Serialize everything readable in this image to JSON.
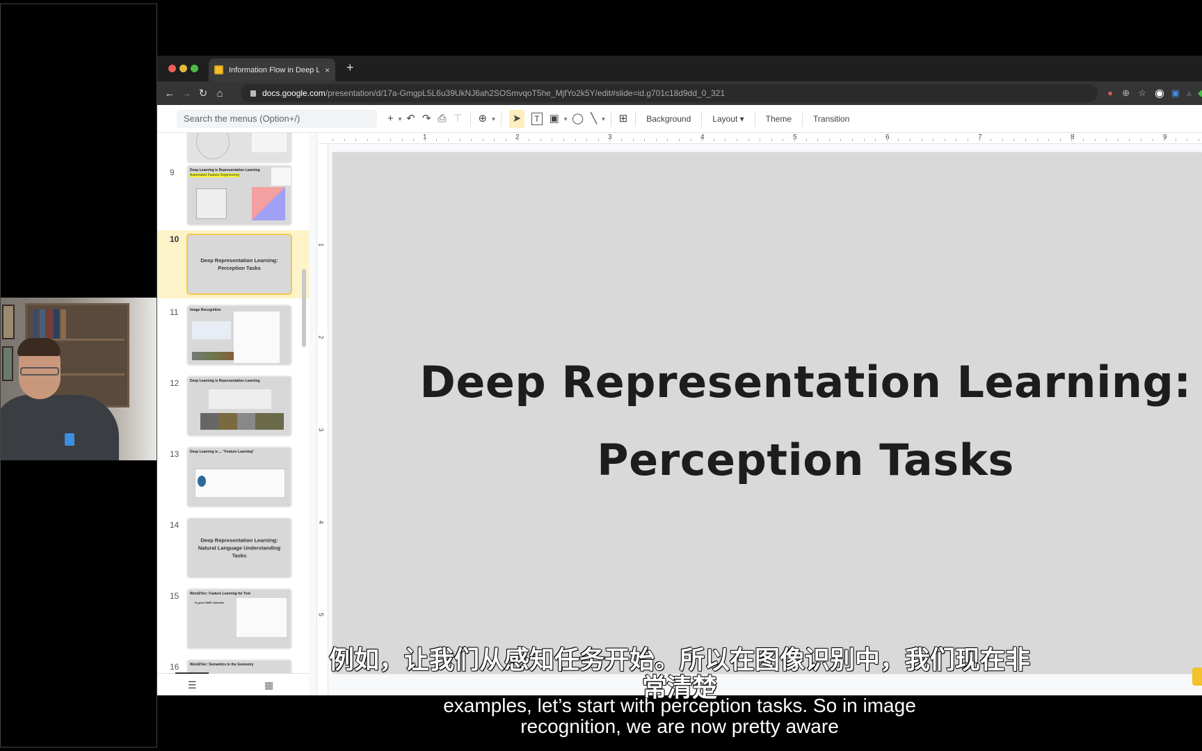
{
  "browser": {
    "tab_title": "Information Flow in Deep Learn",
    "tab_close": "×",
    "new_tab": "+",
    "nav": {
      "back": "←",
      "forward": "→",
      "reload": "↻",
      "home": "⌂"
    },
    "url_host": "docs.google.com",
    "url_path": "/presentation/d/17a-GmgpL5L6u39UkNJ6ah2SOSmvqoT5he_MjfYo2k5Y/edit#slide=id.g701c18d9dd_0_321",
    "extension_icons": [
      "mic-muted-icon",
      "zoom-icon",
      "star-icon",
      "buffer-icon",
      "docs-extension-icon",
      "more-icon",
      "shield-icon"
    ]
  },
  "toolbar": {
    "search_placeholder": "Search the menus (Option+/)",
    "icons": {
      "new": "+",
      "dropdown": "▾",
      "undo": "↶",
      "redo": "↷",
      "print": "⎙",
      "paint_format": "▾",
      "zoom": "⊕",
      "select": "➤",
      "textbox": "T",
      "image": "▣",
      "shape": "◯",
      "line": "╲",
      "comment": "⊞"
    },
    "background_label": "Background",
    "layout_label": "Layout ▾",
    "theme_label": "Theme",
    "transition_label": "Transition"
  },
  "ruler": {
    "horizontal": [
      "1",
      "2",
      "3",
      "4",
      "5",
      "6",
      "7",
      "8",
      "9"
    ],
    "vertical": [
      "1",
      "2",
      "3",
      "4",
      "5"
    ]
  },
  "filmstrip": {
    "slides": [
      {
        "num": "",
        "title": "",
        "sub": ""
      },
      {
        "num": "9",
        "title": "Deep Learning is Representation Learning",
        "sub": "Automated Feature Engineering"
      },
      {
        "num": "10",
        "title": "Deep Representation Learning: Perception Tasks",
        "active": true
      },
      {
        "num": "11",
        "title": "Image Recognition",
        "sub": ""
      },
      {
        "num": "12",
        "title": "Deep Learning is Representation Learning",
        "sub": ""
      },
      {
        "num": "13",
        "title": "Deep Learning is ... \"Feature Learning\"",
        "sub": ""
      },
      {
        "num": "14",
        "title": "Deep Representation Learning: Natural Language Understanding Tasks"
      },
      {
        "num": "15",
        "title": "Word2Vec: Feature Learning for Text",
        "sub": "N-gram NMR classifier"
      },
      {
        "num": "16",
        "title": "Word2Vec: Semantics in the Geometry",
        "sub": ""
      }
    ],
    "footer": {
      "list_view": "☰",
      "grid_view": "▦"
    }
  },
  "slide": {
    "title_line1": "Deep Representation Learning:",
    "title_line2": "Perception Tasks"
  },
  "subtitles": {
    "chinese_line1": "例如，让我们从感知任务开始。所以在图像识别中，我们现在非",
    "chinese_line2": "常清楚",
    "english_line1": "examples, let’s start with perception tasks. So in image",
    "english_line2": "recognition, we are now pretty aware"
  },
  "colors": {
    "active_slide_bg": "#fdf3c8",
    "active_slide_border": "#f2c94c",
    "slide_bg": "#d9d9d9",
    "accent": "#f3c12b"
  }
}
